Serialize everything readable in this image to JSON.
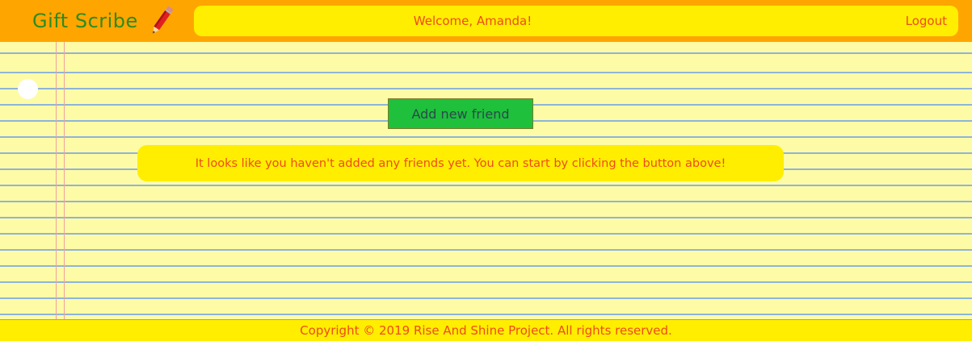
{
  "header": {
    "brand": "Gift Scribe",
    "brand_icon": "pencil-icon",
    "welcome": "Welcome, Amanda!",
    "logout": "Logout"
  },
  "main": {
    "add_friend_label": "Add new friend",
    "empty_message": "It looks like you haven't added any friends yet. You can start by clicking the button above!"
  },
  "footer": {
    "copyright": "Copyright © 2019 Rise And Shine Project. All rights reserved."
  },
  "colors": {
    "header_bg": "#ffa500",
    "bar_bg": "#ffee00",
    "paper_bg": "#fefba6",
    "accent_text": "#f04a1a",
    "brand_text": "#2e8b22",
    "button_bg": "#1fc03c"
  }
}
